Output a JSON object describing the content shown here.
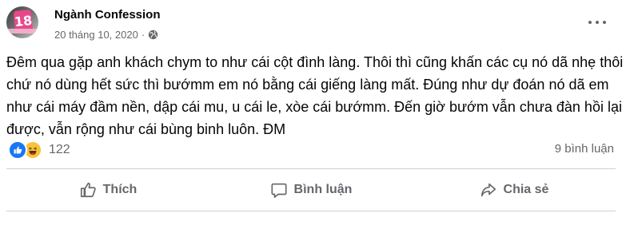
{
  "header": {
    "page_name": "Ngành Confession",
    "timestamp": "20 tháng 10, 2020",
    "separator": "·",
    "avatar_text": "18"
  },
  "post": {
    "lines": [
      "Đêm qua gặp anh khách chym to như cái cột đình làng. Thôi thì cũng khấn các cụ nó dã nhẹ thôi",
      "chứ nó dùng hết sức thì bướmm em nó bằng cái giếng làng mất. Đúng như dự đoán nó dã em",
      "như cái máy đầm nền, dập cái mu, u cái le, xòe cái bướmm. Đến giờ bướm vẫn chưa đàn hồi lại",
      "được, vẫn rộng như cái bùng binh luôn. ĐM"
    ]
  },
  "stats": {
    "reaction_count": "122",
    "comment_count": "9 bình luận",
    "reaction_icons": [
      "like-icon",
      "haha-icon"
    ]
  },
  "actions": {
    "like_label": "Thích",
    "comment_label": "Bình luận",
    "share_label": "Chia sẻ"
  },
  "colors": {
    "like_blue": "#1877f2",
    "haha_yellow": "#f7c33b",
    "secondary_text": "#65676b",
    "divider": "#ced0d4"
  }
}
